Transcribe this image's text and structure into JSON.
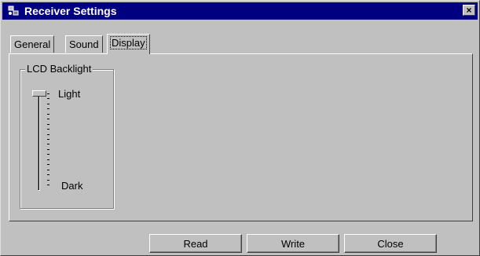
{
  "window": {
    "title": "Receiver Settings",
    "close_label": "×"
  },
  "tabs": [
    {
      "label": "General",
      "active": false
    },
    {
      "label": "Sound",
      "active": false
    },
    {
      "label": "Display",
      "active": true
    }
  ],
  "display": {
    "group_title": "LCD Backlight",
    "slider": {
      "max_label": "Light",
      "min_label": "Dark",
      "value": 1.0
    }
  },
  "buttons": {
    "read": "Read",
    "write": "Write",
    "close": "Close"
  },
  "colors": {
    "titlebar": "#000080",
    "face": "#c0c0c0"
  },
  "icons": {
    "app": "receiver-app-icon",
    "close": "close-icon"
  }
}
